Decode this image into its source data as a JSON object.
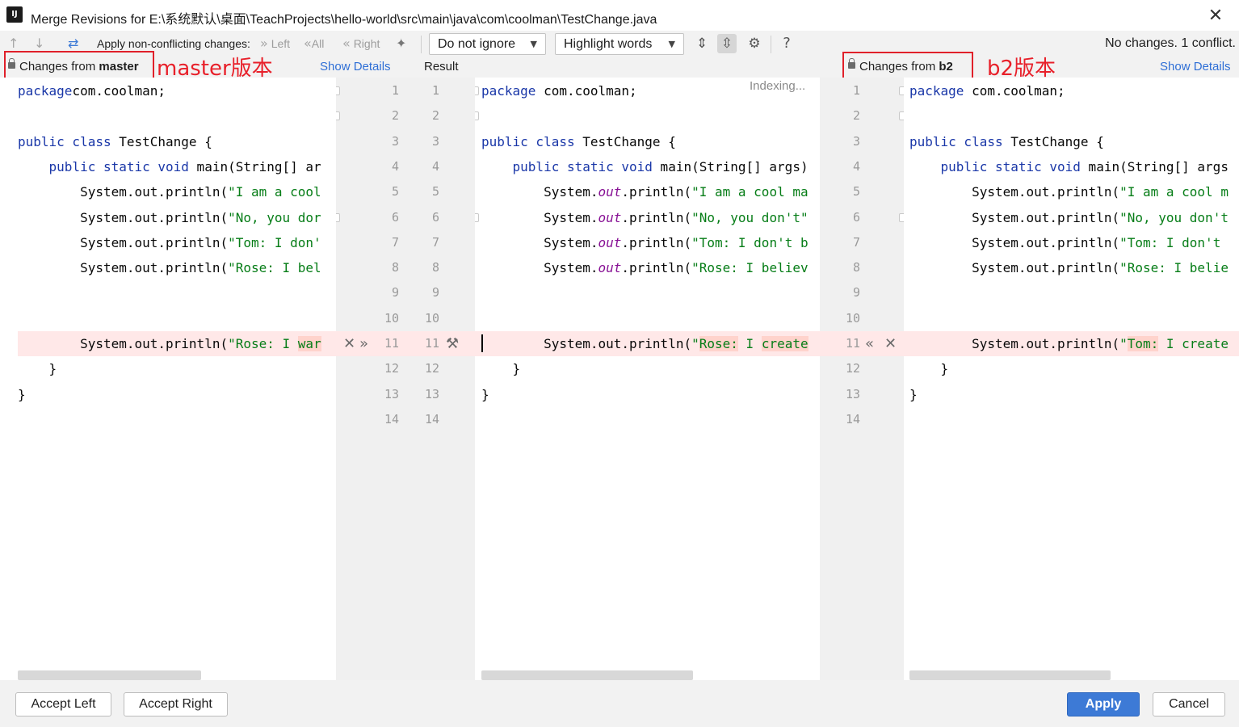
{
  "window": {
    "title": "Merge Revisions for E:\\系统默认\\桌面\\TeachProjects\\hello-world\\src\\main\\java\\com\\coolman\\TestChange.java",
    "app_icon_text": "IJ"
  },
  "toolbar": {
    "apply_label": "Apply non-conflicting changes:",
    "left": "Left",
    "all": "All",
    "right": "Right",
    "ignore_combo": "Do not ignore",
    "highlight_combo": "Highlight words",
    "help": "?",
    "status": "No changes. 1 conflict."
  },
  "panels": {
    "left": {
      "label_prefix": "Changes from ",
      "branch": "master",
      "annotation": "master版本",
      "show_details": "Show Details"
    },
    "middle": {
      "label": "Result",
      "indexing": "Indexing..."
    },
    "right": {
      "label_prefix": "Changes from ",
      "branch": "b2",
      "annotation": "b2版本",
      "show_details": "Show Details"
    }
  },
  "gutters": {
    "left_numbers": [
      "1",
      "2",
      "3",
      "4",
      "5",
      "6",
      "7",
      "8",
      "9",
      "10",
      "11",
      "12",
      "13",
      "14"
    ],
    "result_numbers": [
      "1",
      "2",
      "3",
      "4",
      "5",
      "6",
      "7",
      "8",
      "9",
      "10",
      "11",
      "12",
      "13",
      "14"
    ],
    "right_numbers": [
      "1",
      "2",
      "3",
      "4",
      "5",
      "6",
      "7",
      "8",
      "9",
      "10",
      "11",
      "12",
      "13",
      "14"
    ],
    "conflict_line": 11
  },
  "code": {
    "left": [
      [
        [
          "kw",
          "package"
        ],
        [
          "",
          "com.coolman;"
        ]
      ],
      [],
      [
        [
          "kw",
          "public class"
        ],
        [
          "",
          " TestChange {"
        ]
      ],
      [
        [
          "",
          "    "
        ],
        [
          "kw",
          "public static void"
        ],
        [
          "",
          " main(String[] ar"
        ]
      ],
      [
        [
          "",
          "        System.out.println("
        ],
        [
          "str",
          "\"I am a cool"
        ]
      ],
      [
        [
          "",
          "        System.out.println("
        ],
        [
          "str",
          "\"No, you dor"
        ]
      ],
      [
        [
          "",
          "        System.out.println("
        ],
        [
          "str",
          "\"Tom: I don'"
        ]
      ],
      [
        [
          "",
          "        System.out.println("
        ],
        [
          "str",
          "\"Rose: I bel"
        ]
      ],
      [],
      [],
      [
        [
          "",
          "        System.out.println("
        ],
        [
          "str",
          "\"Rose: I "
        ],
        [
          "hlstr",
          "war"
        ]
      ],
      [
        [
          "",
          "    }"
        ]
      ],
      [
        [
          "",
          "}"
        ]
      ],
      []
    ],
    "middle": [
      [
        [
          "kw",
          "package"
        ],
        [
          "",
          " com.coolman;"
        ]
      ],
      [],
      [
        [
          "kw",
          "public class"
        ],
        [
          "",
          " TestChange {"
        ]
      ],
      [
        [
          "",
          "    "
        ],
        [
          "kw",
          "public static void"
        ],
        [
          "",
          " main(String[] args)"
        ]
      ],
      [
        [
          "",
          "        System."
        ],
        [
          "fld",
          "out"
        ],
        [
          "",
          ".println("
        ],
        [
          "str",
          "\"I am a cool ma"
        ]
      ],
      [
        [
          "",
          "        System."
        ],
        [
          "fld",
          "out"
        ],
        [
          "",
          ".println("
        ],
        [
          "str",
          "\"No, you don't\""
        ]
      ],
      [
        [
          "",
          "        System."
        ],
        [
          "fld",
          "out"
        ],
        [
          "",
          ".println("
        ],
        [
          "str",
          "\"Tom: I don't b"
        ]
      ],
      [
        [
          "",
          "        System."
        ],
        [
          "fld",
          "out"
        ],
        [
          "",
          ".println("
        ],
        [
          "str",
          "\"Rose: I believ"
        ]
      ],
      [],
      [],
      [
        [
          "",
          "        System.out.println("
        ],
        [
          "str",
          "\""
        ],
        [
          "hlstr",
          "Rose:"
        ],
        [
          "str",
          " I "
        ],
        [
          "hlstr",
          "create"
        ]
      ],
      [
        [
          "",
          "    }"
        ]
      ],
      [
        [
          "",
          "}"
        ]
      ],
      []
    ],
    "right": [
      [
        [
          "kw",
          "package"
        ],
        [
          "",
          " com.coolman;"
        ]
      ],
      [],
      [
        [
          "kw",
          "public class"
        ],
        [
          "",
          " TestChange {"
        ]
      ],
      [
        [
          "",
          "    "
        ],
        [
          "kw",
          "public static void"
        ],
        [
          "",
          " main(String[] args"
        ]
      ],
      [
        [
          "",
          "        System.out.println("
        ],
        [
          "str",
          "\"I am a cool m"
        ]
      ],
      [
        [
          "",
          "        System.out.println("
        ],
        [
          "str",
          "\"No, you don't"
        ]
      ],
      [
        [
          "",
          "        System.out.println("
        ],
        [
          "str",
          "\"Tom: I don't "
        ]
      ],
      [
        [
          "",
          "        System.out.println("
        ],
        [
          "str",
          "\"Rose: I belie"
        ]
      ],
      [],
      [],
      [
        [
          "",
          "        System.out.println("
        ],
        [
          "str",
          "\""
        ],
        [
          "hlstr",
          "Tom:"
        ],
        [
          "str",
          " I create"
        ]
      ],
      [
        [
          "",
          "    }"
        ]
      ],
      [
        [
          "",
          "}"
        ]
      ],
      []
    ]
  },
  "buttons": {
    "accept_left": "Accept Left",
    "accept_right": "Accept Right",
    "apply": "Apply",
    "cancel": "Cancel"
  },
  "colors": {
    "keyword": "#1a37a8",
    "string": "#067d17",
    "field": "#871094",
    "conflict_bg": "#ffe8e8",
    "annotation_red": "#e8202a",
    "link_blue": "#2f6fd6",
    "primary_button": "#3d7ad6"
  }
}
